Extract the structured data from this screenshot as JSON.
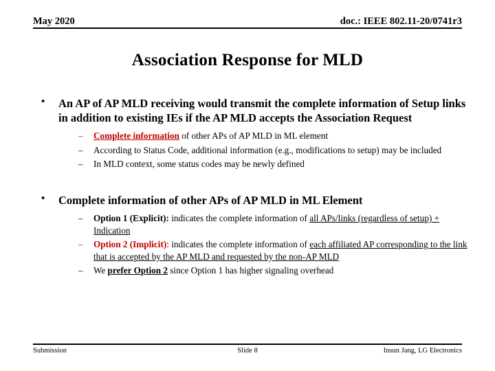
{
  "header": {
    "date": "May 2020",
    "doc": "doc.: IEEE 802.11-20/0741r3"
  },
  "title": "Association Response for MLD",
  "colors": {
    "accent_red": "#C00000",
    "text": "#000000",
    "background": "#FFFFFF"
  },
  "body": {
    "bullet_marker": "•",
    "dash_marker": "–",
    "blocks": [
      {
        "level1": "An AP of AP MLD receiving would transmit the complete information of Setup links in addition to existing IEs if the AP MLD accepts the Association Request",
        "sub": [
          {
            "parts": [
              {
                "text": "Complete information",
                "style": "red-bu"
              },
              {
                "text": " of other APs of AP MLD in ML element",
                "style": ""
              }
            ],
            "dash_color": "red"
          },
          {
            "parts": [
              {
                "text": "According to Status Code, additional information (e.g., modifications to setup) may be included",
                "style": ""
              }
            ],
            "dash_color": "black"
          },
          {
            "parts": [
              {
                "text": "In MLD context, some status codes may be newly defined",
                "style": ""
              }
            ],
            "dash_color": "black"
          }
        ]
      },
      {
        "level1": "Complete information of other APs of AP MLD in ML Element",
        "sub": [
          {
            "parts": [
              {
                "text": "Option 1 (Explicit):",
                "style": "bold"
              },
              {
                "text": " indicates the complete information of ",
                "style": ""
              },
              {
                "text": "all APs/links (regardless of setup) + Indication",
                "style": "u"
              }
            ],
            "dash_color": "black"
          },
          {
            "parts": [
              {
                "text": "Option 2 (Implicit)",
                "style": "red-b"
              },
              {
                "text": ": indicates the complete information of ",
                "style": ""
              },
              {
                "text": "each affiliated AP corresponding to the link that is accepted by the AP MLD and requested by the non-AP MLD",
                "style": "u"
              }
            ],
            "dash_color": "red"
          },
          {
            "parts": [
              {
                "text": "We ",
                "style": ""
              },
              {
                "text": "prefer Option 2",
                "style": "blk-bu"
              },
              {
                "text": " since Option 1 has higher signaling overhead",
                "style": ""
              }
            ],
            "dash_color": "black"
          }
        ]
      }
    ]
  },
  "footer": {
    "left": "Submission",
    "center": "Slide 8",
    "right": "Insun Jang, LG Electronics"
  }
}
